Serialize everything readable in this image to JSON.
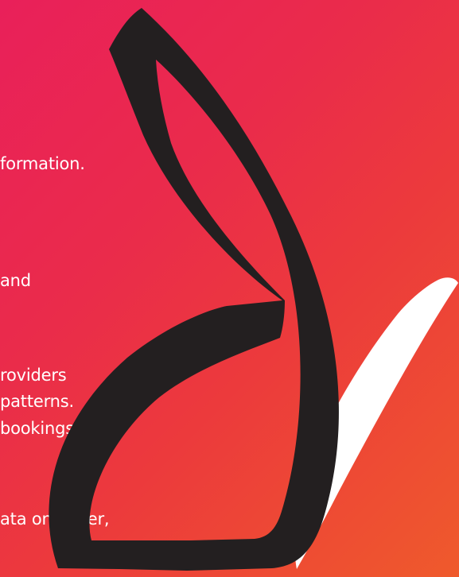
{
  "text_fragments": [
    "formation.",
    "and",
    "roviders",
    "patterns.",
    "bookings,",
    "ata on water,"
  ],
  "colors": {
    "gradient_top": "#e9205a",
    "gradient_bottom": "#ef5a2c",
    "crescent": "#231f20",
    "check": "#ffffff",
    "text": "#ffffff"
  },
  "icons": [
    "crescent-logo-shape",
    "white-check-stroke"
  ]
}
